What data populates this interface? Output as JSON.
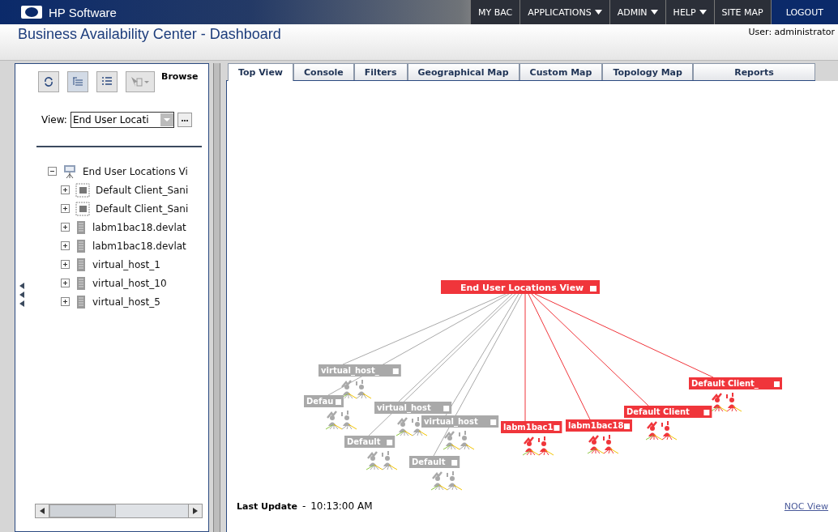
{
  "header": {
    "brand": "HP Software",
    "nav": [
      {
        "label": "MY BAC",
        "has_menu": false,
        "selected": false
      },
      {
        "label": "APPLICATIONS",
        "has_menu": true,
        "selected": false
      },
      {
        "label": "ADMIN",
        "has_menu": true,
        "selected": false
      },
      {
        "label": "HELP",
        "has_menu": true,
        "selected": false
      },
      {
        "label": "SITE MAP",
        "has_menu": false,
        "selected": false
      },
      {
        "label": "LOGOUT",
        "has_menu": false,
        "selected": true
      }
    ]
  },
  "title": "Business Availability Center - Dashboard",
  "user": "User: administrator",
  "sidebar": {
    "browse_label": "Browse",
    "view_label": "View:",
    "view_value": "End User Locati",
    "tree": [
      {
        "label": "End User Locations Vi",
        "kind": "view",
        "expanded": true,
        "children": [
          {
            "label": "Default Client_Sani",
            "kind": "client",
            "expanded": false
          },
          {
            "label": "Default Client_Sani",
            "kind": "client",
            "expanded": false
          },
          {
            "label": "labm1bac18.devlat",
            "kind": "host",
            "expanded": false
          },
          {
            "label": "labm1bac18.devlat",
            "kind": "host",
            "expanded": false
          },
          {
            "label": "virtual_host_1",
            "kind": "host",
            "expanded": false
          },
          {
            "label": "virtual_host_10",
            "kind": "host",
            "expanded": false
          },
          {
            "label": "virtual_host_5",
            "kind": "host",
            "expanded": false
          }
        ]
      }
    ]
  },
  "tabs": [
    {
      "label": "Top View",
      "selected": true
    },
    {
      "label": "Console",
      "selected": false
    },
    {
      "label": "Filters",
      "selected": false
    },
    {
      "label": "Geographical Map",
      "selected": false
    },
    {
      "label": "Custom Map",
      "selected": false
    },
    {
      "label": "Topology Map",
      "selected": false
    },
    {
      "label": "Reports",
      "selected": false
    }
  ],
  "topology": {
    "root": {
      "label": "End User Locations View",
      "color": "#f0353b"
    },
    "nodes": [
      {
        "label": "virtual_host_",
        "color": "#a9a9a9"
      },
      {
        "label": "Defau",
        "color": "#a9a9a9"
      },
      {
        "label": "virtual_host",
        "color": "#a9a9a9"
      },
      {
        "label": "Default",
        "color": "#a9a9a9"
      },
      {
        "label": "virtual_host",
        "color": "#a9a9a9"
      },
      {
        "label": "Default",
        "color": "#a9a9a9"
      },
      {
        "label": "labm1bac1",
        "color": "#f0353b"
      },
      {
        "label": "labm1bac18",
        "color": "#f0353b"
      },
      {
        "label": "Default Client",
        "color": "#f0353b"
      },
      {
        "label": "Default Client_",
        "color": "#f0353b"
      }
    ]
  },
  "footer": {
    "last_update_label": "Last Update",
    "separator": "-",
    "last_update_value": "10:13:00 AM",
    "link": "NOC View"
  }
}
